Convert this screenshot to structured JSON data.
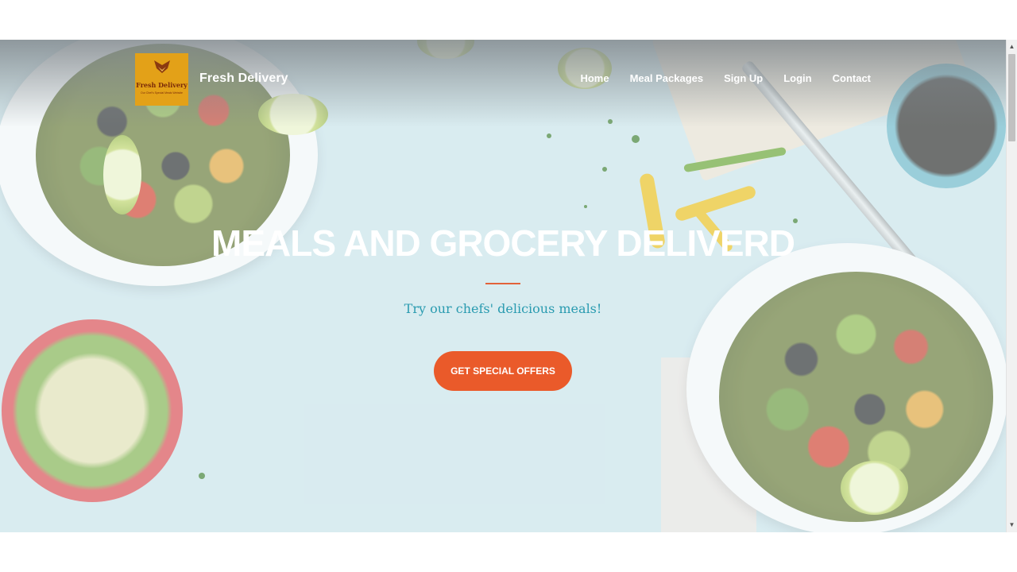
{
  "brand": {
    "logo_name": "Fresh Delivery",
    "logo_tagline": "Our Chef's Special Meals Website",
    "name": "Fresh Delivery"
  },
  "nav": {
    "items": [
      {
        "label": "Home"
      },
      {
        "label": "Meal Packages"
      },
      {
        "label": "Sign Up"
      },
      {
        "label": "Login"
      },
      {
        "label": "Contact"
      }
    ]
  },
  "hero": {
    "title": "MEALS AND GROCERY DELIVERD",
    "subtitle": "Try our chefs' delicious meals!",
    "cta_label": "GET SPECIAL OFFERS"
  },
  "colors": {
    "accent": "#ea5a2a",
    "subtitle": "#2a9bb0",
    "logo_bg": "#e3a118",
    "hero_bg": "#cfe6ec"
  }
}
